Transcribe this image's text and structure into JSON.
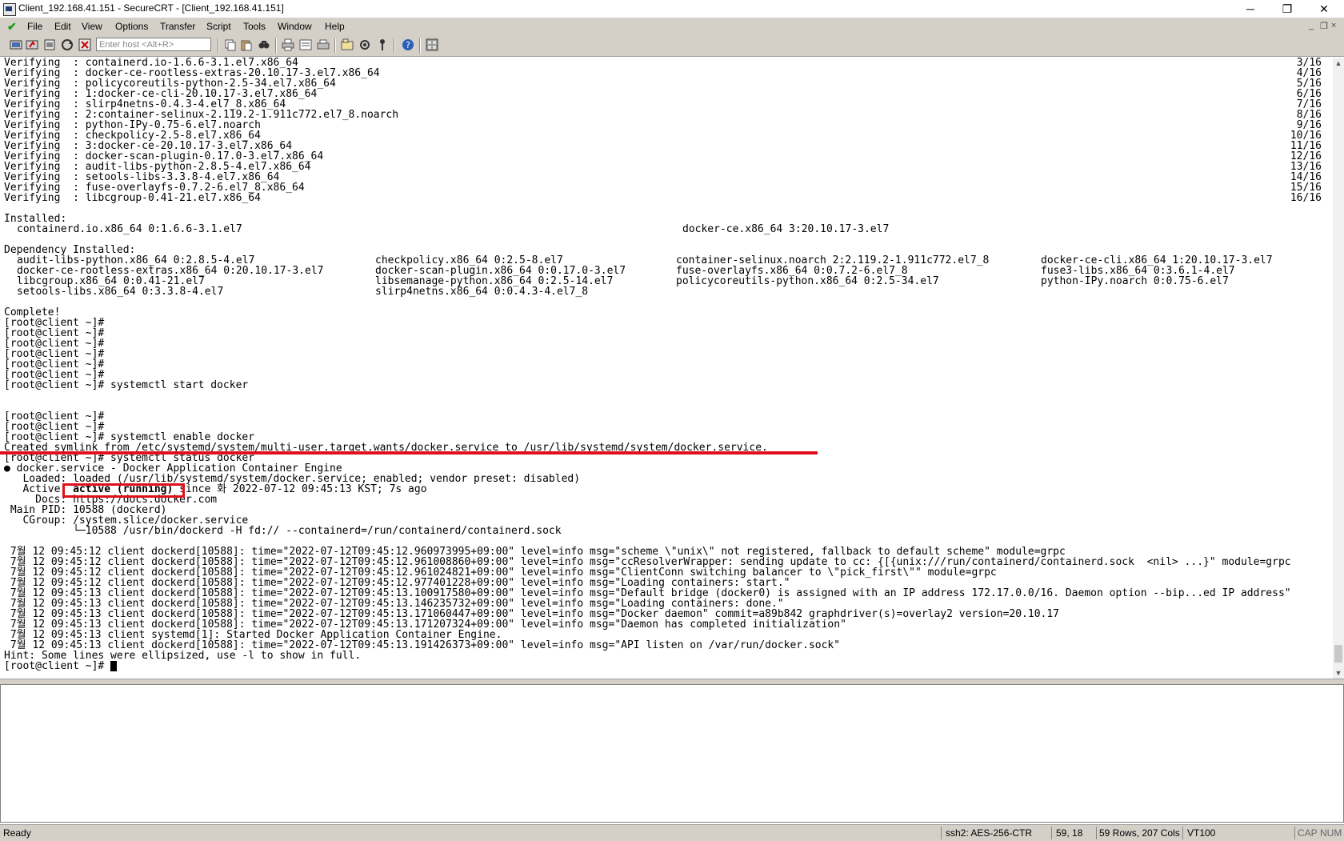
{
  "window": {
    "title": "Client_192.168.41.151 - SecureCRT - [Client_192.168.41.151]",
    "controls": {
      "minimize": "─",
      "restore": "❐",
      "close": "✕"
    }
  },
  "menu": {
    "items": [
      "File",
      "Edit",
      "View",
      "Options",
      "Transfer",
      "Script",
      "Tools",
      "Window",
      "Help"
    ],
    "mdi_controls": [
      "_",
      "❐",
      "×"
    ]
  },
  "toolbar": {
    "host_placeholder": "Enter host <Alt+R>"
  },
  "terminal": {
    "verify": [
      {
        "label": "Verifying  : containerd.io-1.6.6-3.1.el7.x86_64",
        "count": "3/16"
      },
      {
        "label": "Verifying  : docker-ce-rootless-extras-20.10.17-3.el7.x86_64",
        "count": "4/16"
      },
      {
        "label": "Verifying  : policycoreutils-python-2.5-34.el7.x86_64",
        "count": "5/16"
      },
      {
        "label": "Verifying  : 1:docker-ce-cli-20.10.17-3.el7.x86_64",
        "count": "6/16"
      },
      {
        "label": "Verifying  : slirp4netns-0.4.3-4.el7_8.x86_64",
        "count": "7/16"
      },
      {
        "label": "Verifying  : 2:container-selinux-2.119.2-1.911c772.el7_8.noarch",
        "count": "8/16"
      },
      {
        "label": "Verifying  : python-IPy-0.75-6.el7.noarch",
        "count": "9/16"
      },
      {
        "label": "Verifying  : checkpolicy-2.5-8.el7.x86_64",
        "count": "10/16"
      },
      {
        "label": "Verifying  : 3:docker-ce-20.10.17-3.el7.x86_64",
        "count": "11/16"
      },
      {
        "label": "Verifying  : docker-scan-plugin-0.17.0-3.el7.x86_64",
        "count": "12/16"
      },
      {
        "label": "Verifying  : audit-libs-python-2.8.5-4.el7.x86_64",
        "count": "13/16"
      },
      {
        "label": "Verifying  : setools-libs-3.3.8-4.el7.x86_64",
        "count": "14/16"
      },
      {
        "label": "Verifying  : fuse-overlayfs-0.7.2-6.el7_8.x86_64",
        "count": "15/16"
      },
      {
        "label": "Verifying  : libcgroup-0.41-21.el7.x86_64",
        "count": "16/16"
      }
    ],
    "installed_header": "Installed:",
    "installed": [
      "containerd.io.x86_64 0:1.6.6-3.1.el7",
      "docker-ce.x86_64 3:20.10.17-3.el7"
    ],
    "dependency_header": "Dependency Installed:",
    "dependencies": [
      [
        "audit-libs-python.x86_64 0:2.8.5-4.el7",
        "checkpolicy.x86_64 0:2.5-8.el7",
        "container-selinux.noarch 2:2.119.2-1.911c772.el7_8",
        "docker-ce-cli.x86_64 1:20.10.17-3.el7"
      ],
      [
        "docker-ce-rootless-extras.x86_64 0:20.10.17-3.el7",
        "docker-scan-plugin.x86_64 0:0.17.0-3.el7",
        "fuse-overlayfs.x86_64 0:0.7.2-6.el7_8",
        "fuse3-libs.x86_64 0:3.6.1-4.el7"
      ],
      [
        "libcgroup.x86_64 0:0.41-21.el7",
        "libsemanage-python.x86_64 0:2.5-14.el7",
        "policycoreutils-python.x86_64 0:2.5-34.el7",
        "python-IPy.noarch 0:0.75-6.el7"
      ],
      [
        "setools-libs.x86_64 0:3.3.8-4.el7",
        "slirp4netns.x86_64 0:0.4.3-4.el7_8",
        "",
        ""
      ]
    ],
    "complete": "Complete!",
    "prompt": "[root@client ~]#",
    "cmd_start": "[root@client ~]# systemctl start docker",
    "cmd_enable": "[root@client ~]# systemctl enable docker",
    "symlink": "Created symlink from /etc/systemd/system/multi-user.target.wants/docker.service to /usr/lib/systemd/system/docker.service.",
    "cmd_status": "[root@client ~]# systemctl status docker",
    "svc_line": "● docker.service - Docker Application Container Engine",
    "loaded_line": "   Loaded: loaded (/usr/lib/systemd/system/docker.service; enabled; vendor preset: disabled)",
    "active_prefix": "   Active: ",
    "active_state": "active (running)",
    "active_suffix": " since 화 2022-07-12 09:45:13 KST; 7s ago",
    "docs_line": "     Docs: https://docs.docker.com",
    "mainpid_line": " Main PID: 10588 (dockerd)",
    "cgroup_line": "   CGroup: /system.slice/docker.service",
    "cgroup_proc": "           └─10588 /usr/bin/dockerd -H fd:// --containerd=/run/containerd/containerd.sock",
    "logs": [
      " 7월 12 09:45:12 client dockerd[10588]: time=\"2022-07-12T09:45:12.960973995+09:00\" level=info msg=\"scheme \\\"unix\\\" not registered, fallback to default scheme\" module=grpc",
      " 7월 12 09:45:12 client dockerd[10588]: time=\"2022-07-12T09:45:12.961008860+09:00\" level=info msg=\"ccResolverWrapper: sending update to cc: {[{unix:///run/containerd/containerd.sock  <nil> ...}\" module=grpc",
      " 7월 12 09:45:12 client dockerd[10588]: time=\"2022-07-12T09:45:12.961024821+09:00\" level=info msg=\"ClientConn switching balancer to \\\"pick_first\\\"\" module=grpc",
      " 7월 12 09:45:12 client dockerd[10588]: time=\"2022-07-12T09:45:12.977401228+09:00\" level=info msg=\"Loading containers: start.\"",
      " 7월 12 09:45:13 client dockerd[10588]: time=\"2022-07-12T09:45:13.100917580+09:00\" level=info msg=\"Default bridge (docker0) is assigned with an IP address 172.17.0.0/16. Daemon option --bip...ed IP address\"",
      " 7월 12 09:45:13 client dockerd[10588]: time=\"2022-07-12T09:45:13.146235732+09:00\" level=info msg=\"Loading containers: done.\"",
      " 7월 12 09:45:13 client dockerd[10588]: time=\"2022-07-12T09:45:13.171060447+09:00\" level=info msg=\"Docker daemon\" commit=a89b842 graphdriver(s)=overlay2 version=20.10.17",
      " 7월 12 09:45:13 client dockerd[10588]: time=\"2022-07-12T09:45:13.171207324+09:00\" level=info msg=\"Daemon has completed initialization\"",
      " 7월 12 09:45:13 client systemd[1]: Started Docker Application Container Engine.",
      " 7월 12 09:45:13 client dockerd[10588]: time=\"2022-07-12T09:45:13.191426373+09:00\" level=info msg=\"API listen on /var/run/docker.sock\""
    ],
    "hint": "Hint: Some lines were ellipsized, use -l to show in full.",
    "final_prompt": "[root@client ~]# "
  },
  "statusbar": {
    "ready": "Ready",
    "cipher": "ssh2: AES-256-CTR",
    "position": "59,  18",
    "size": "59 Rows, 207 Cols",
    "emulation": "VT100",
    "cap": "CAP",
    "num": "NUM"
  }
}
